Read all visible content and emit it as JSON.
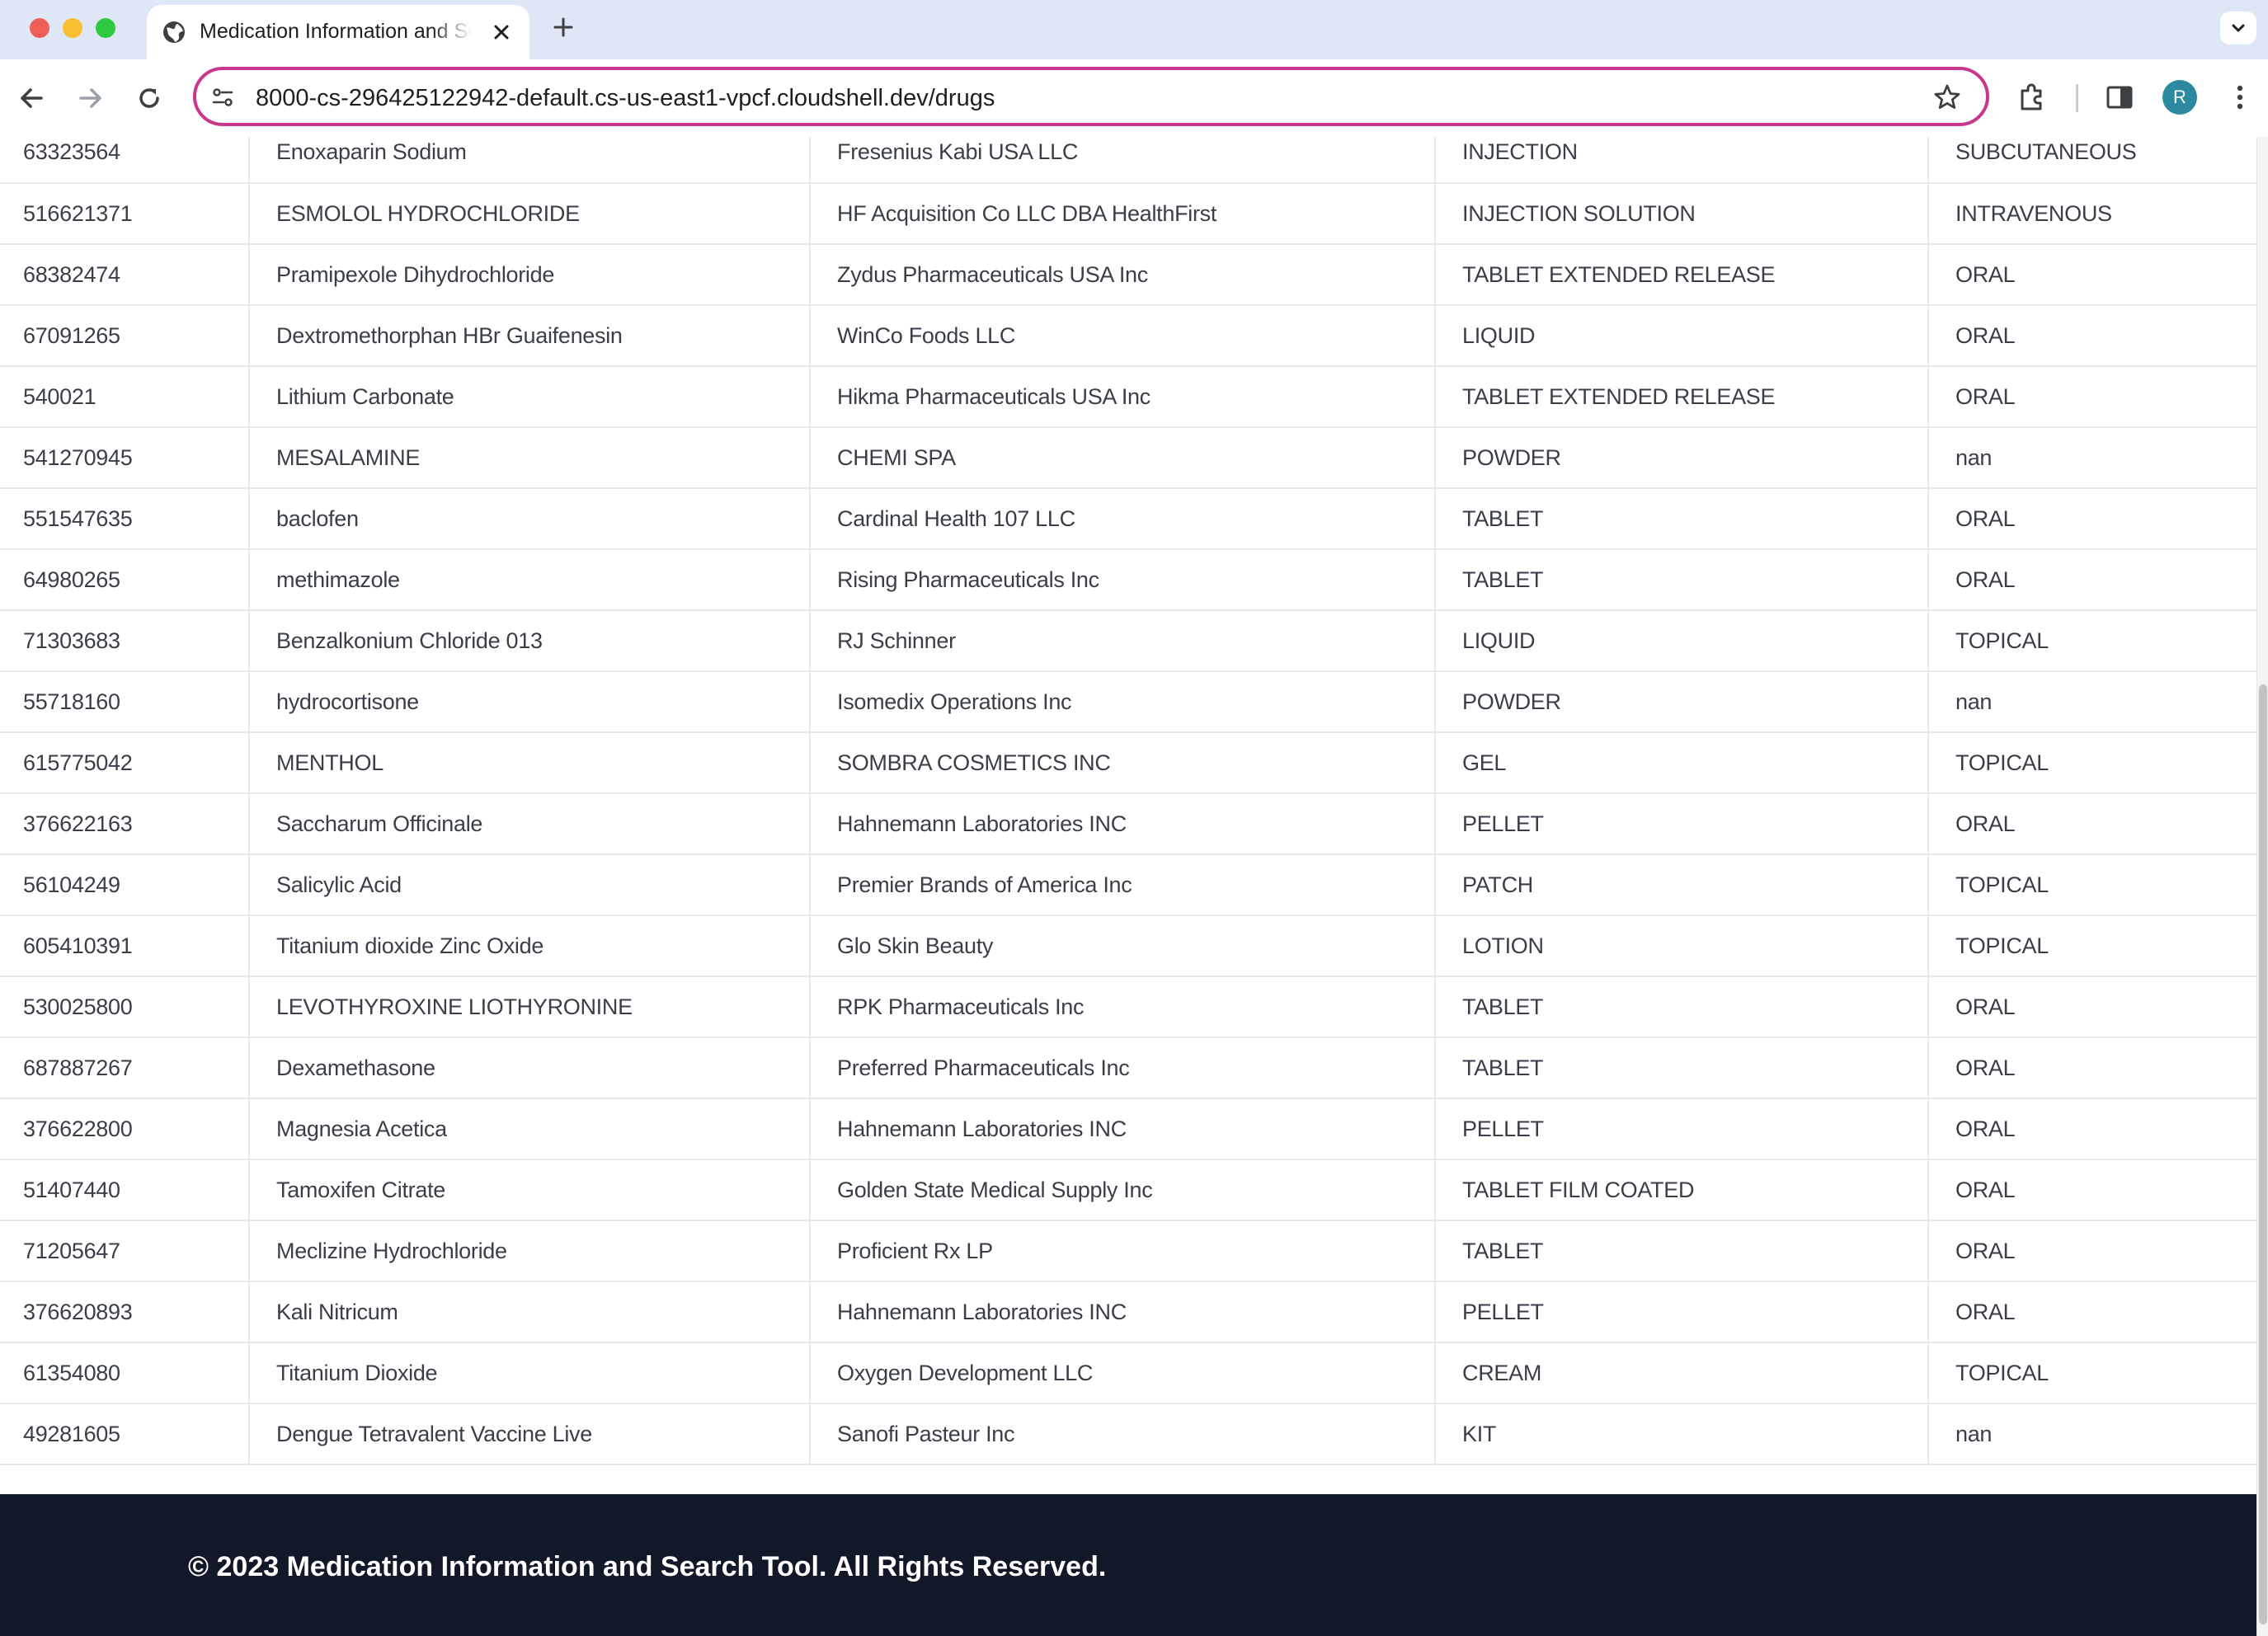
{
  "browser": {
    "tab_title": "Medication Information and Search Tool",
    "url": "8000-cs-296425122942-default.cs-us-east1-vpcf.cloudshell.dev/drugs",
    "profile_initial": "R"
  },
  "drugs": {
    "rows": [
      [
        "63323564",
        "Enoxaparin Sodium",
        "Fresenius Kabi USA LLC",
        "INJECTION",
        "SUBCUTANEOUS"
      ],
      [
        "516621371",
        "ESMOLOL HYDROCHLORIDE",
        "HF Acquisition Co LLC DBA HealthFirst",
        "INJECTION SOLUTION",
        "INTRAVENOUS"
      ],
      [
        "68382474",
        "Pramipexole Dihydrochloride",
        "Zydus Pharmaceuticals USA Inc",
        "TABLET EXTENDED RELEASE",
        "ORAL"
      ],
      [
        "67091265",
        "Dextromethorphan HBr Guaifenesin",
        "WinCo Foods LLC",
        "LIQUID",
        "ORAL"
      ],
      [
        "540021",
        "Lithium Carbonate",
        "Hikma Pharmaceuticals USA Inc",
        "TABLET EXTENDED RELEASE",
        "ORAL"
      ],
      [
        "541270945",
        "MESALAMINE",
        "CHEMI SPA",
        "POWDER",
        "nan"
      ],
      [
        "551547635",
        "baclofen",
        "Cardinal Health 107 LLC",
        "TABLET",
        "ORAL"
      ],
      [
        "64980265",
        "methimazole",
        "Rising Pharmaceuticals Inc",
        "TABLET",
        "ORAL"
      ],
      [
        "71303683",
        "Benzalkonium Chloride 013",
        "RJ Schinner",
        "LIQUID",
        "TOPICAL"
      ],
      [
        "55718160",
        "hydrocortisone",
        "Isomedix Operations Inc",
        "POWDER",
        "nan"
      ],
      [
        "615775042",
        "MENTHOL",
        "SOMBRA COSMETICS INC",
        "GEL",
        "TOPICAL"
      ],
      [
        "376622163",
        "Saccharum Officinale",
        "Hahnemann Laboratories INC",
        "PELLET",
        "ORAL"
      ],
      [
        "56104249",
        "Salicylic Acid",
        "Premier Brands of America Inc",
        "PATCH",
        "TOPICAL"
      ],
      [
        "605410391",
        "Titanium dioxide Zinc Oxide",
        "Glo Skin Beauty",
        "LOTION",
        "TOPICAL"
      ],
      [
        "530025800",
        "LEVOTHYROXINE LIOTHYRONINE",
        "RPK Pharmaceuticals Inc",
        "TABLET",
        "ORAL"
      ],
      [
        "687887267",
        "Dexamethasone",
        "Preferred Pharmaceuticals Inc",
        "TABLET",
        "ORAL"
      ],
      [
        "376622800",
        "Magnesia Acetica",
        "Hahnemann Laboratories INC",
        "PELLET",
        "ORAL"
      ],
      [
        "51407440",
        "Tamoxifen Citrate",
        "Golden State Medical Supply Inc",
        "TABLET FILM COATED",
        "ORAL"
      ],
      [
        "71205647",
        "Meclizine Hydrochloride",
        "Proficient Rx LP",
        "TABLET",
        "ORAL"
      ],
      [
        "376620893",
        "Kali Nitricum",
        "Hahnemann Laboratories INC",
        "PELLET",
        "ORAL"
      ],
      [
        "61354080",
        "Titanium Dioxide",
        "Oxygen Development LLC",
        "CREAM",
        "TOPICAL"
      ],
      [
        "49281605",
        "Dengue Tetravalent Vaccine Live",
        "Sanofi Pasteur Inc",
        "KIT",
        "nan"
      ]
    ]
  },
  "footer": {
    "text": "© 2023 Medication Information and Search Tool. All Rights Reserved."
  },
  "colors": {
    "tabstrip_bg": "#dfe6f6",
    "omnibox_border": "#c9378c",
    "footer_bg": "#111827",
    "avatar_bg": "#2b8aa0"
  }
}
